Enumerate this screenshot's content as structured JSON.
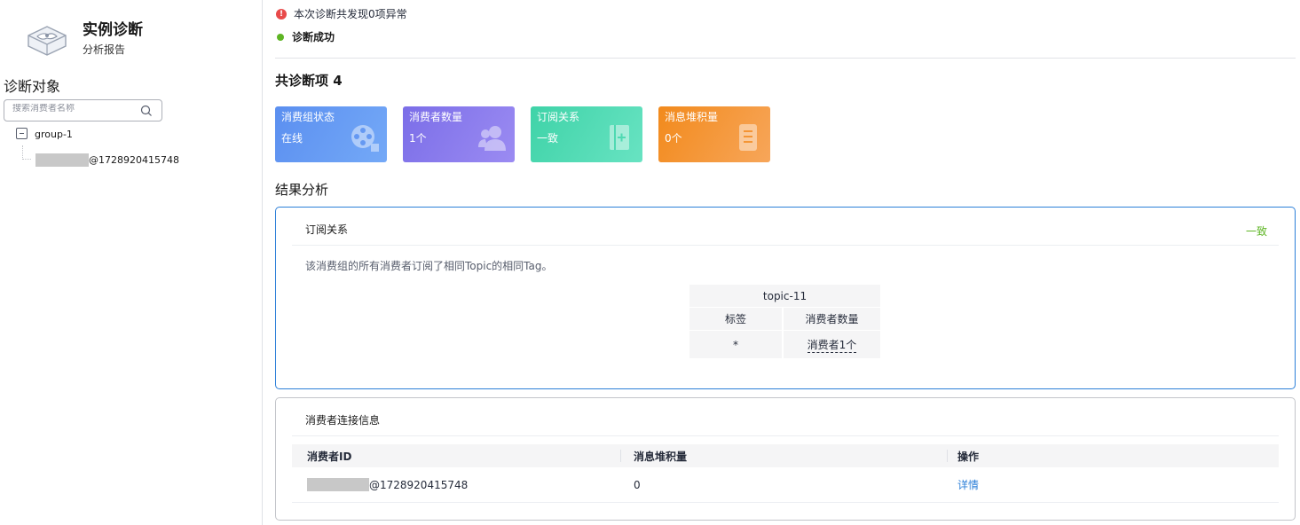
{
  "sidebar": {
    "app_title": "实例诊断",
    "app_subtitle": "分析报告",
    "objects_title": "诊断对象",
    "search_placeholder": "搜索消费者名称",
    "tree": {
      "group": "group-1",
      "consumer_suffix": "@1728920415748"
    }
  },
  "summary": {
    "alert": "本次诊断共发现0项异常",
    "status": "诊断成功",
    "count_label": "共诊断项 4"
  },
  "cards": [
    {
      "title": "消费组状态",
      "value": "在线",
      "icon": "film-reel-icon",
      "color": "#5b8ff0"
    },
    {
      "title": "消费者数量",
      "value": "1个",
      "icon": "users-icon",
      "color": "#7b6ee8"
    },
    {
      "title": "订阅关系",
      "value": "一致",
      "icon": "book-plus-icon",
      "color": "#3fd3a8"
    },
    {
      "title": "消息堆积量",
      "value": "0个",
      "icon": "document-icon",
      "color": "#f28a1c"
    }
  ],
  "result": {
    "title": "结果分析",
    "subscription": {
      "title": "订阅关系",
      "status": "一致",
      "description": "该消费组的所有消费者订阅了相同Topic的相同Tag。",
      "table": {
        "topic": "topic-11",
        "headers": [
          "标签",
          "消费者数量"
        ],
        "row": [
          "*",
          "消费者1个"
        ]
      }
    },
    "connection": {
      "title": "消费者连接信息",
      "headers": [
        "消费者ID",
        "消息堆积量",
        "操作"
      ],
      "rows": [
        {
          "id_suffix": "@1728920415748",
          "backlog": "0",
          "action": "详情"
        }
      ]
    }
  }
}
